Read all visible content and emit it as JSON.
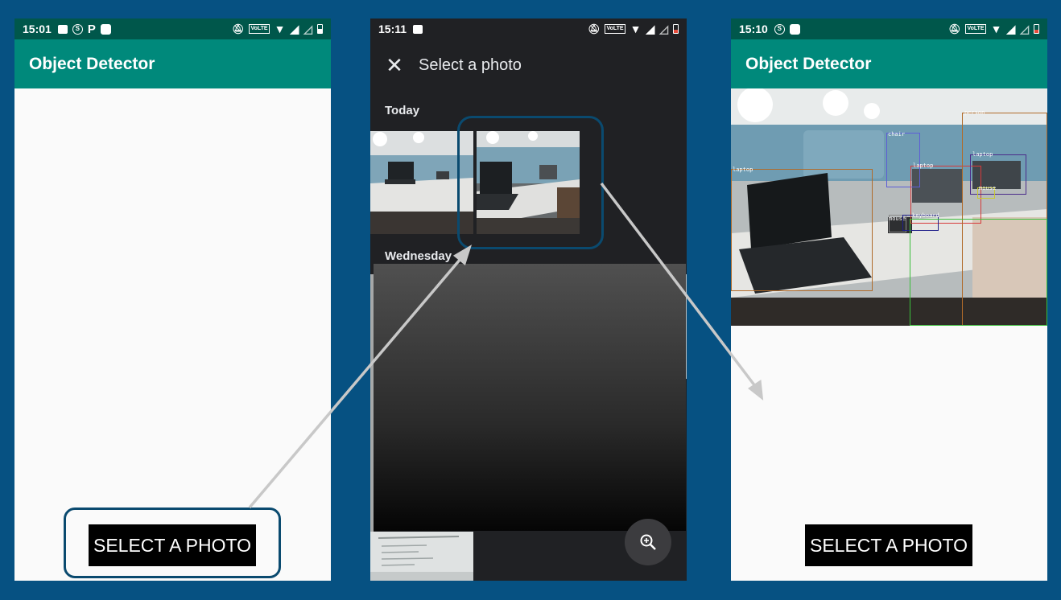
{
  "phones": {
    "left": {
      "status_time": "15:01",
      "app_title": "Object Detector",
      "button_label": "SELECT A PHOTO"
    },
    "middle": {
      "status_time": "15:11",
      "picker_title": "Select a photo",
      "section_today": "Today",
      "section_wednesday": "Wednesday"
    },
    "right": {
      "status_time": "15:10",
      "app_title": "Object Detector",
      "button_label": "SELECT A PHOTO",
      "detections": [
        "person",
        "chair",
        "laptop",
        "laptop",
        "laptop",
        "mouse",
        "mouse",
        "keyboard"
      ]
    }
  },
  "colors": {
    "background": "#065182",
    "appbar": "#00897b",
    "statusbar": "#00574b",
    "highlight": "#0a4a6f"
  },
  "icons": [
    "image-icon",
    "s-icon",
    "p-icon",
    "app-icon",
    "mute-icon",
    "volte-icon",
    "wifi-icon",
    "signal-icon",
    "battery-icon",
    "close-icon",
    "zoom-in-icon"
  ]
}
